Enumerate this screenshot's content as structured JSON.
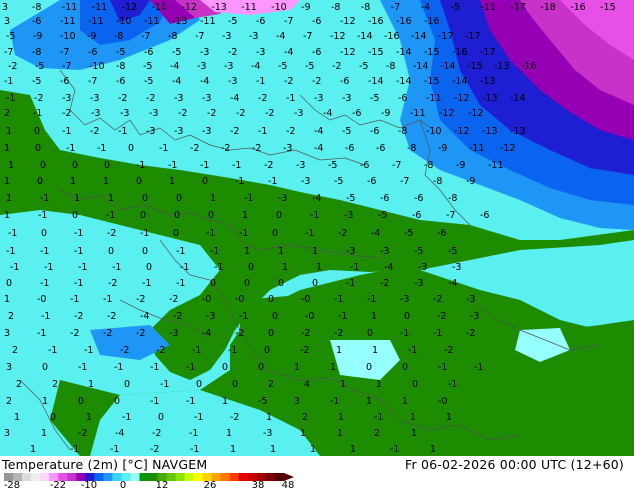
{
  "footer": {
    "title": "Temperature (2m) [°C] NAVGEM",
    "datetime": "Fr 06-02-2026 00:00 UTC (12+60)"
  },
  "colorbar": {
    "ticks": [
      "-28",
      "-22",
      "-10",
      "0",
      "12",
      "26",
      "38",
      "48"
    ],
    "colors": [
      "#969696",
      "#b4b4b4",
      "#dcdcdc",
      "#eeeeee",
      "#ffd7ff",
      "#ff96ff",
      "#e650e6",
      "#c832c8",
      "#9600b4",
      "#1e1ed2",
      "#0a64f0",
      "#1e96f5",
      "#3cd2f0",
      "#5af0f0",
      "#96ffff",
      "#0a9600",
      "#1e8c00",
      "#46aa00",
      "#64c800",
      "#8ce600",
      "#c8ff00",
      "#ffff00",
      "#ffd200",
      "#ffa000",
      "#ff7800",
      "#ff3c00",
      "#e60000",
      "#c80000",
      "#a00000",
      "#780000",
      "#500000"
    ]
  },
  "map_labels": [
    {
      "t": "3"
    },
    {
      "t": "-8"
    },
    {
      "t": "-11"
    },
    {
      "t": "-11"
    },
    {
      "t": "-12"
    },
    {
      "t": "-11"
    },
    {
      "t": "-12"
    },
    {
      "t": "-13"
    },
    {
      "t": "-11"
    },
    {
      "t": "-10"
    },
    {
      "t": "-9"
    },
    {
      "t": "-8"
    },
    {
      "t": "-8"
    },
    {
      "t": "-7"
    },
    {
      "t": "-4"
    },
    {
      "t": "-5"
    },
    {
      "t": "-11"
    },
    {
      "t": "-17"
    },
    {
      "t": "-18"
    },
    {
      "t": "-16"
    },
    {
      "t": "-15"
    },
    {
      "t": "3"
    },
    {
      "t": "-6"
    },
    {
      "t": "-11"
    },
    {
      "t": "-11"
    },
    {
      "t": "-10"
    },
    {
      "t": "-11"
    },
    {
      "t": "-13"
    },
    {
      "t": "-11"
    },
    {
      "t": "-5"
    },
    {
      "t": "-6"
    },
    {
      "t": "-7"
    },
    {
      "t": "-6"
    },
    {
      "t": "-12"
    },
    {
      "t": "-16"
    },
    {
      "t": "-16"
    },
    {
      "t": "-16"
    },
    {
      "t": "-5"
    },
    {
      "t": "-9"
    },
    {
      "t": "-10"
    },
    {
      "t": "-9"
    },
    {
      "t": "-8"
    },
    {
      "t": "-7"
    },
    {
      "t": "-8"
    },
    {
      "t": "-7"
    },
    {
      "t": "-3"
    },
    {
      "t": "-3"
    },
    {
      "t": "-4"
    },
    {
      "t": "-7"
    },
    {
      "t": "-12"
    },
    {
      "t": "-14"
    },
    {
      "t": "-16"
    },
    {
      "t": "-14"
    },
    {
      "t": "-17"
    },
    {
      "t": "-17"
    },
    {
      "t": "-7"
    },
    {
      "t": "-8"
    },
    {
      "t": "-7"
    },
    {
      "t": "-6"
    },
    {
      "t": "-5"
    },
    {
      "t": "-6"
    },
    {
      "t": "-5"
    },
    {
      "t": "-3"
    },
    {
      "t": "-2"
    },
    {
      "t": "-3"
    },
    {
      "t": "-4"
    },
    {
      "t": "-6"
    },
    {
      "t": "-12"
    },
    {
      "t": "-15"
    },
    {
      "t": "-14"
    },
    {
      "t": "-15"
    },
    {
      "t": "-16"
    },
    {
      "t": "-17"
    },
    {
      "t": "-2"
    },
    {
      "t": "-5"
    },
    {
      "t": "-7"
    },
    {
      "t": "-10"
    },
    {
      "t": "-8"
    },
    {
      "t": "-5"
    },
    {
      "t": "-4"
    },
    {
      "t": "-3"
    },
    {
      "t": "-3"
    },
    {
      "t": "-4"
    },
    {
      "t": "-5"
    },
    {
      "t": "-5"
    },
    {
      "t": "-2"
    },
    {
      "t": "-5"
    },
    {
      "t": "-8"
    },
    {
      "t": "-14"
    },
    {
      "t": "-14"
    },
    {
      "t": "-15"
    },
    {
      "t": "-13"
    },
    {
      "t": "-16"
    },
    {
      "t": "-1"
    },
    {
      "t": "-5"
    },
    {
      "t": "-6"
    },
    {
      "t": "-7"
    },
    {
      "t": "-6"
    },
    {
      "t": "-5"
    },
    {
      "t": "-4"
    },
    {
      "t": "-4"
    },
    {
      "t": "-3"
    },
    {
      "t": "-1"
    },
    {
      "t": "-2"
    },
    {
      "t": "-2"
    },
    {
      "t": "-6"
    },
    {
      "t": "-14"
    },
    {
      "t": "-14"
    },
    {
      "t": "-15"
    },
    {
      "t": "-14"
    },
    {
      "t": "-13"
    },
    {
      "t": "-1"
    },
    {
      "t": "-2"
    },
    {
      "t": "-3"
    },
    {
      "t": "-3"
    },
    {
      "t": "-2"
    },
    {
      "t": "-2"
    },
    {
      "t": "-3"
    },
    {
      "t": "-3"
    },
    {
      "t": "-4"
    },
    {
      "t": "-2"
    },
    {
      "t": "-1"
    },
    {
      "t": "-3"
    },
    {
      "t": "-3"
    },
    {
      "t": "-5"
    },
    {
      "t": "-6"
    },
    {
      "t": "-11"
    },
    {
      "t": "-12"
    },
    {
      "t": "-13"
    },
    {
      "t": "-14"
    },
    {
      "t": "2"
    },
    {
      "t": "-1"
    },
    {
      "t": "-2"
    },
    {
      "t": "-3"
    },
    {
      "t": "-3"
    },
    {
      "t": "-3"
    },
    {
      "t": "-2"
    },
    {
      "t": "-2"
    },
    {
      "t": "-2"
    },
    {
      "t": "-2"
    },
    {
      "t": "-3"
    },
    {
      "t": "-4"
    },
    {
      "t": "-6"
    },
    {
      "t": "-9"
    },
    {
      "t": "-11"
    },
    {
      "t": "-12"
    },
    {
      "t": "-12"
    },
    {
      "t": "1"
    },
    {
      "t": "0"
    },
    {
      "t": "-1"
    },
    {
      "t": "-2"
    },
    {
      "t": "-1"
    },
    {
      "t": "-3"
    },
    {
      "t": "-3"
    },
    {
      "t": "-3"
    },
    {
      "t": "-2"
    },
    {
      "t": "-1"
    },
    {
      "t": "-2"
    },
    {
      "t": "-4"
    },
    {
      "t": "-5"
    },
    {
      "t": "-6"
    },
    {
      "t": "-8"
    },
    {
      "t": "-10"
    },
    {
      "t": "-12"
    },
    {
      "t": "-13"
    },
    {
      "t": "-13"
    },
    {
      "t": "1"
    },
    {
      "t": "0"
    },
    {
      "t": "-1"
    },
    {
      "t": "-1"
    },
    {
      "t": "0"
    },
    {
      "t": "-1"
    },
    {
      "t": "-2"
    },
    {
      "t": "-2"
    },
    {
      "t": "-2"
    },
    {
      "t": "-3"
    },
    {
      "t": "-4"
    },
    {
      "t": "-6"
    },
    {
      "t": "-6"
    },
    {
      "t": "-8"
    },
    {
      "t": "-9"
    },
    {
      "t": "-11"
    },
    {
      "t": "-12"
    },
    {
      "t": "1"
    },
    {
      "t": "0"
    },
    {
      "t": "0"
    },
    {
      "t": "0"
    },
    {
      "t": "-1"
    },
    {
      "t": "-1"
    },
    {
      "t": "-1"
    },
    {
      "t": "-1"
    },
    {
      "t": "-2"
    },
    {
      "t": "-3"
    },
    {
      "t": "-5"
    },
    {
      "t": "-6"
    },
    {
      "t": "-7"
    },
    {
      "t": "-8"
    },
    {
      "t": "-9"
    },
    {
      "t": "-11"
    },
    {
      "t": "1"
    },
    {
      "t": "0"
    },
    {
      "t": "1"
    },
    {
      "t": "1"
    },
    {
      "t": "0"
    },
    {
      "t": "1"
    },
    {
      "t": "0"
    },
    {
      "t": "-1"
    },
    {
      "t": "-1"
    },
    {
      "t": "-3"
    },
    {
      "t": "-5"
    },
    {
      "t": "-6"
    },
    {
      "t": "-7"
    },
    {
      "t": "-8"
    },
    {
      "t": "-9"
    },
    {
      "t": "1"
    },
    {
      "t": "-1"
    },
    {
      "t": "1"
    },
    {
      "t": "1"
    },
    {
      "t": "0"
    },
    {
      "t": "0"
    },
    {
      "t": "1"
    },
    {
      "t": "-1"
    },
    {
      "t": "-3"
    },
    {
      "t": "-4"
    },
    {
      "t": "-5"
    },
    {
      "t": "-6"
    },
    {
      "t": "-6"
    },
    {
      "t": "-8"
    },
    {
      "t": "1"
    },
    {
      "t": "-1"
    },
    {
      "t": "0"
    },
    {
      "t": "-1"
    },
    {
      "t": "0"
    },
    {
      "t": "0"
    },
    {
      "t": "0"
    },
    {
      "t": "1"
    },
    {
      "t": "0"
    },
    {
      "t": "-1"
    },
    {
      "t": "-3"
    },
    {
      "t": "-5"
    },
    {
      "t": "-6"
    },
    {
      "t": "-7"
    },
    {
      "t": "-6"
    },
    {
      "t": "-1"
    },
    {
      "t": "0"
    },
    {
      "t": "-1"
    },
    {
      "t": "-2"
    },
    {
      "t": "-1"
    },
    {
      "t": "0"
    },
    {
      "t": "-1"
    },
    {
      "t": "-1"
    },
    {
      "t": "0"
    },
    {
      "t": "-1"
    },
    {
      "t": "-2"
    },
    {
      "t": "-4"
    },
    {
      "t": "-5"
    },
    {
      "t": "-6"
    },
    {
      "t": "-1"
    },
    {
      "t": "-1"
    },
    {
      "t": "-1"
    },
    {
      "t": "0"
    },
    {
      "t": "0"
    },
    {
      "t": "-1"
    },
    {
      "t": "-1"
    },
    {
      "t": "1"
    },
    {
      "t": "1"
    },
    {
      "t": "1"
    },
    {
      "t": "-3"
    },
    {
      "t": "-3"
    },
    {
      "t": "-5"
    },
    {
      "t": "-5"
    },
    {
      "t": "-1"
    },
    {
      "t": "-1"
    },
    {
      "t": "-1"
    },
    {
      "t": "-1"
    },
    {
      "t": "0"
    },
    {
      "t": "-1"
    },
    {
      "t": "-1"
    },
    {
      "t": "0"
    },
    {
      "t": "1"
    },
    {
      "t": "1"
    },
    {
      "t": "-1"
    },
    {
      "t": "-4"
    },
    {
      "t": "-3"
    },
    {
      "t": "-3"
    },
    {
      "t": "0"
    },
    {
      "t": "-1"
    },
    {
      "t": "-1"
    },
    {
      "t": "-2"
    },
    {
      "t": "-1"
    },
    {
      "t": "-1"
    },
    {
      "t": "0"
    },
    {
      "t": "0"
    },
    {
      "t": "0"
    },
    {
      "t": "0"
    },
    {
      "t": "-1"
    },
    {
      "t": "-2"
    },
    {
      "t": "-3"
    },
    {
      "t": "-4"
    },
    {
      "t": "1"
    },
    {
      "t": "-0"
    },
    {
      "t": "-1"
    },
    {
      "t": "-1"
    },
    {
      "t": "-2"
    },
    {
      "t": "-2"
    },
    {
      "t": "-0"
    },
    {
      "t": "-0"
    },
    {
      "t": "0"
    },
    {
      "t": "-0"
    },
    {
      "t": "-1"
    },
    {
      "t": "-1"
    },
    {
      "t": "-3"
    },
    {
      "t": "-2"
    },
    {
      "t": "-3"
    },
    {
      "t": "2"
    },
    {
      "t": "-1"
    },
    {
      "t": "-2"
    },
    {
      "t": "-2"
    },
    {
      "t": "-4"
    },
    {
      "t": "-2"
    },
    {
      "t": "-3"
    },
    {
      "t": "-1"
    },
    {
      "t": "0"
    },
    {
      "t": "-0"
    },
    {
      "t": "-1"
    },
    {
      "t": "1"
    },
    {
      "t": "0"
    },
    {
      "t": "-2"
    },
    {
      "t": "-3"
    },
    {
      "t": "3"
    },
    {
      "t": "-1"
    },
    {
      "t": "-2"
    },
    {
      "t": "-2"
    },
    {
      "t": "-2"
    },
    {
      "t": "-3"
    },
    {
      "t": "-4"
    },
    {
      "t": "-2"
    },
    {
      "t": "0"
    },
    {
      "t": "-2"
    },
    {
      "t": "-2"
    },
    {
      "t": "0"
    },
    {
      "t": "-1"
    },
    {
      "t": "-1"
    },
    {
      "t": "-2"
    },
    {
      "t": "2"
    },
    {
      "t": "-1"
    },
    {
      "t": "-1"
    },
    {
      "t": "-2"
    },
    {
      "t": "-2"
    },
    {
      "t": "-1"
    },
    {
      "t": "-1"
    },
    {
      "t": "0"
    },
    {
      "t": "-2"
    },
    {
      "t": "1"
    },
    {
      "t": "1"
    },
    {
      "t": "-1"
    },
    {
      "t": "-2"
    },
    {
      "t": "3"
    },
    {
      "t": "0"
    },
    {
      "t": "-1"
    },
    {
      "t": "-1"
    },
    {
      "t": "-1"
    },
    {
      "t": "-1"
    },
    {
      "t": "0"
    },
    {
      "t": "0"
    },
    {
      "t": "1"
    },
    {
      "t": "1"
    },
    {
      "t": "0"
    },
    {
      "t": "0"
    },
    {
      "t": "-1"
    },
    {
      "t": "-1"
    },
    {
      "t": "2"
    },
    {
      "t": "2"
    },
    {
      "t": "1"
    },
    {
      "t": "0"
    },
    {
      "t": "-1"
    },
    {
      "t": "0"
    },
    {
      "t": "0"
    },
    {
      "t": "2"
    },
    {
      "t": "4"
    },
    {
      "t": "1"
    },
    {
      "t": "1"
    },
    {
      "t": "0"
    },
    {
      "t": "-1"
    },
    {
      "t": "2"
    },
    {
      "t": "1"
    },
    {
      "t": "0"
    },
    {
      "t": "0"
    },
    {
      "t": "-1"
    },
    {
      "t": "-1"
    },
    {
      "t": "1"
    },
    {
      "t": "-5"
    },
    {
      "t": "3"
    },
    {
      "t": "-1"
    },
    {
      "t": "1"
    },
    {
      "t": "1"
    },
    {
      "t": "-0"
    },
    {
      "t": "1"
    },
    {
      "t": "0"
    },
    {
      "t": "1"
    },
    {
      "t": "-1"
    },
    {
      "t": "0"
    },
    {
      "t": "-1"
    },
    {
      "t": "-2"
    },
    {
      "t": "1"
    },
    {
      "t": "2"
    },
    {
      "t": "1"
    },
    {
      "t": "-1"
    },
    {
      "t": "1"
    },
    {
      "t": "1"
    },
    {
      "t": "3"
    },
    {
      "t": "1"
    },
    {
      "t": "-2"
    },
    {
      "t": "-4"
    },
    {
      "t": "-2"
    },
    {
      "t": "-1"
    },
    {
      "t": "1"
    },
    {
      "t": "-3"
    },
    {
      "t": "1"
    },
    {
      "t": "1"
    },
    {
      "t": "2"
    },
    {
      "t": "1"
    },
    {
      "t": "1"
    },
    {
      "t": "-1"
    },
    {
      "t": "-1"
    },
    {
      "t": "-2"
    },
    {
      "t": "-1"
    },
    {
      "t": "1"
    },
    {
      "t": "1"
    },
    {
      "t": "1"
    },
    {
      "t": "1"
    },
    {
      "t": "-1"
    },
    {
      "t": "1"
    }
  ]
}
